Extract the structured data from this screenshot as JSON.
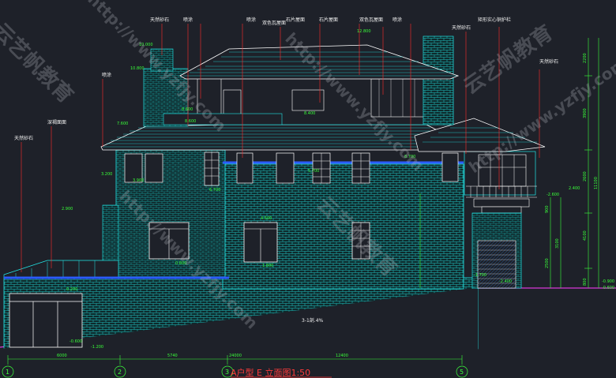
{
  "drawing": {
    "title": "A户型 E 立面图1:50",
    "callouts": [
      "天然砂石",
      "喷涂",
      "喷涂",
      "双色瓦屋面",
      "石片屋面",
      "石片屋面",
      "双色瓦屋面",
      "喷涂",
      "天然砂石",
      "矩形实心铜护栏",
      "天然砂石",
      "喷涂",
      "天然砂石",
      "深褐面面"
    ],
    "axis_labels": [
      "1",
      "2",
      "3",
      "5"
    ],
    "bottom_dims": [
      "6000",
      "5740",
      "24000",
      "12400"
    ],
    "right_dims": [
      "2200",
      "3900",
      "2600",
      "11100",
      "4100",
      "3100",
      "2500",
      "800",
      "900"
    ],
    "section_mark": "3-1剖.4%",
    "elevations": [
      "10.000",
      "8.600",
      "10.800",
      "8.600",
      "8.400",
      "8.700",
      "7.600",
      "6.700",
      "5.700",
      "4.500",
      "3.900",
      "3.200",
      "2.900",
      "2.400",
      "1.800",
      "0.800",
      "0.200",
      "-0.600",
      "-1.200",
      "-1.700",
      "-2.400",
      "-2.600",
      "12.800",
      "-0.900",
      "-0.600"
    ],
    "watermarks": [
      "http://www.yzfjy.com",
      "云艺帆教育"
    ]
  },
  "colors": {
    "background": "#1e2129",
    "building": "#22e8e8",
    "roof": "#ffffff",
    "dimension": "#39ff39",
    "leader": "#ff2a2a",
    "ground": "#d838d8",
    "blue": "#2b5cff",
    "title": "#ff3a3a"
  }
}
